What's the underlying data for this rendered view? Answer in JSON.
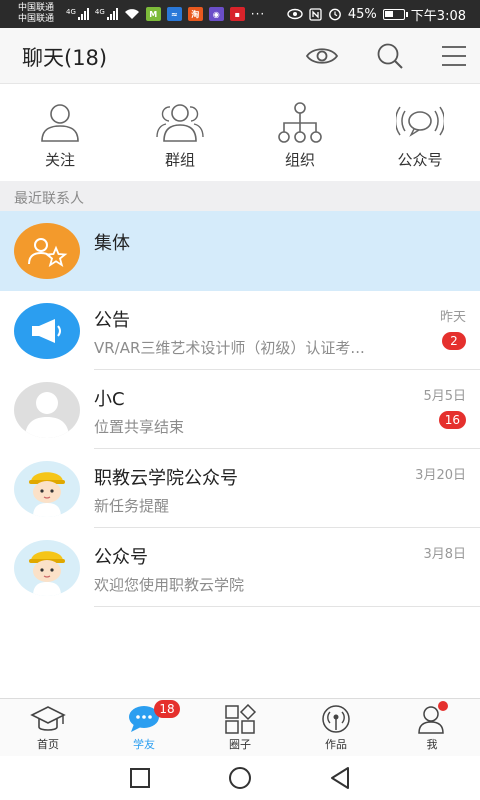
{
  "status_bar": {
    "carrier_1": "中国联通",
    "carrier_2": "中国联通",
    "net_1": "4G",
    "net_2": "4G",
    "notif_3": "淘",
    "battery": "45%",
    "time": "下午3:08",
    "more": "···"
  },
  "header": {
    "title": "聊天(18)"
  },
  "quick": [
    {
      "label": "关注",
      "icon": "follow-person-icon"
    },
    {
      "label": "群组",
      "icon": "group-people-icon"
    },
    {
      "label": "组织",
      "icon": "organization-tree-icon"
    },
    {
      "label": "公众号",
      "icon": "broadcast-bubble-icon"
    }
  ],
  "section_header": "最近联系人",
  "chats": [
    {
      "name": "集体",
      "message": "",
      "time": "",
      "badge": "",
      "pinned": true,
      "avatar": "collective-avatar"
    },
    {
      "name": "公告",
      "message": "VR/AR三维艺术设计师（初级）认证考...",
      "time": "昨天",
      "badge": "2",
      "avatar": "announcement-avatar"
    },
    {
      "name": "小C",
      "message": "位置共享结束",
      "time": "5月5日",
      "badge": "16",
      "avatar": "default-user-avatar"
    },
    {
      "name": "职教云学院公众号",
      "message": "新任务提醒",
      "time": "3月20日",
      "badge": "",
      "avatar": "worker-avatar"
    },
    {
      "name": "公众号",
      "message": "欢迎您使用职教云学院",
      "time": "3月8日",
      "badge": "",
      "avatar": "worker-avatar"
    }
  ],
  "bottom_nav": [
    {
      "label": "首页",
      "icon": "graduation-cap-icon"
    },
    {
      "label": "学友",
      "icon": "chat-bubble-icon",
      "badge": "18",
      "active": true
    },
    {
      "label": "圈子",
      "icon": "apps-grid-icon"
    },
    {
      "label": "作品",
      "icon": "broadcast-icon"
    },
    {
      "label": "我",
      "icon": "profile-icon"
    }
  ],
  "colors": {
    "accent": "#2b9ef0",
    "badge": "#e5302d",
    "pinned_bg": "#d5ebfa",
    "orange_avatar": "#f39a2c"
  }
}
